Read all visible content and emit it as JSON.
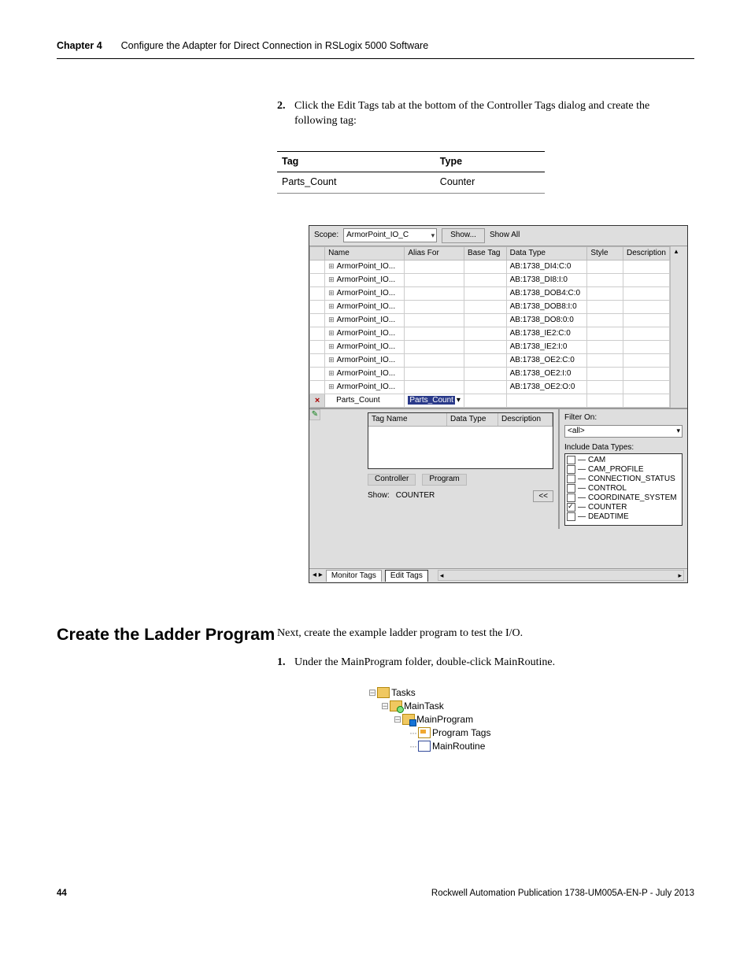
{
  "header": {
    "chapter": "Chapter 4",
    "title": "Configure the Adapter for Direct Connection in RSLogix 5000 Software"
  },
  "step2": {
    "num": "2.",
    "text_a": "Click the Edit Tags tab at the bottom of the Controller Tags dialog and create the following tag:"
  },
  "tagTable": {
    "h1": "Tag",
    "h2": "Type",
    "r1c1": "Parts_Count",
    "r1c2": "Counter"
  },
  "shot": {
    "scope_lbl": "Scope:",
    "scope_val": "ArmorPoint_IO_C",
    "show_btn": "Show...",
    "show_all": "Show All",
    "gridHeaders": [
      "Name",
      "Alias For",
      "Base Tag",
      "Data Type",
      "Style",
      "Description"
    ],
    "rows": [
      {
        "name": "ArmorPoint_IO...",
        "dt": "AB:1738_DI4:C:0"
      },
      {
        "name": "ArmorPoint_IO...",
        "dt": "AB:1738_DI8:I:0"
      },
      {
        "name": "ArmorPoint_IO...",
        "dt": "AB:1738_DOB4:C:0"
      },
      {
        "name": "ArmorPoint_IO...",
        "dt": "AB:1738_DOB8:I:0"
      },
      {
        "name": "ArmorPoint_IO...",
        "dt": "AB:1738_DO8:0:0"
      },
      {
        "name": "ArmorPoint_IO...",
        "dt": "AB:1738_IE2:C:0"
      },
      {
        "name": "ArmorPoint_IO...",
        "dt": "AB:1738_IE2:I:0"
      },
      {
        "name": "ArmorPoint_IO...",
        "dt": "AB:1738_OE2:C:0"
      },
      {
        "name": "ArmorPoint_IO...",
        "dt": "AB:1738_OE2:I:0"
      },
      {
        "name": "ArmorPoint_IO...",
        "dt": "AB:1738_OE2:O:0"
      }
    ],
    "parts_row": {
      "name": "Parts_Count",
      "alias": "Parts_Count"
    },
    "tagname_hdr": "Tag Name",
    "dt_hdr": "Data Type",
    "desc_hdr": "Description",
    "controller_link": "Controller",
    "program_link": "Program",
    "show_label": "Show:",
    "show_value": "COUNTER",
    "collapse_btn": "<<",
    "filter_lbl": "Filter On:",
    "filter_val": "<all>",
    "incl_lbl": "Include Data Types:",
    "dtypes": [
      "CAM",
      "CAM_PROFILE",
      "CONNECTION_STATUS",
      "CONTROL",
      "COORDINATE_SYSTEM",
      "COUNTER",
      "DEADTIME"
    ],
    "tabs": {
      "t1": "Monitor Tags",
      "t2": "Edit Tags"
    },
    "nav_arrows": "◂ ▸"
  },
  "section2": {
    "title": "Create the Ladder Program",
    "intro": "Next, create the example ladder program to test the I/O.",
    "step1_num": "1.",
    "step1_txt": "Under the MainProgram folder, double-click MainRoutine."
  },
  "tree": {
    "tasks": "Tasks",
    "maintask": "MainTask",
    "mainprogram": "MainProgram",
    "progtags": "Program Tags",
    "routine": "MainRoutine"
  },
  "footer": {
    "page": "44",
    "pub": "Rockwell Automation Publication 1738-UM005A-EN-P - July 2013"
  }
}
